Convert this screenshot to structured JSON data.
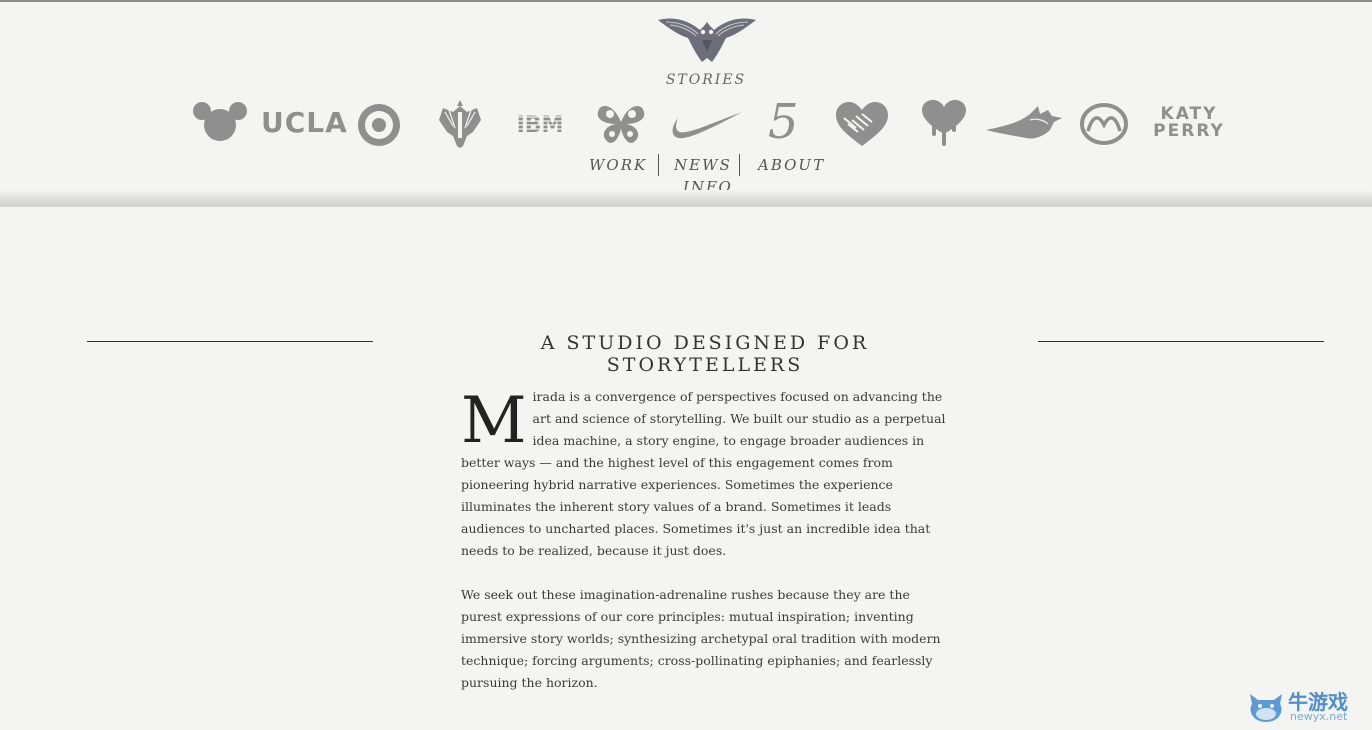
{
  "header": {
    "stories_label": "STORIES",
    "logos": [
      {
        "name": "mickey-logo-icon"
      },
      {
        "name": "ucla-logo",
        "text": "UCLA"
      },
      {
        "name": "target-logo-icon"
      },
      {
        "name": "pacific-rim-logo-icon"
      },
      {
        "name": "ibm-logo",
        "text": "IBM"
      },
      {
        "name": "butterfly-logo-icon"
      },
      {
        "name": "nike-swoosh-icon"
      },
      {
        "name": "five-logo",
        "text": "5"
      },
      {
        "name": "heart-handshake-icon"
      },
      {
        "name": "dripping-heart-icon"
      },
      {
        "name": "dragon-logo-icon"
      },
      {
        "name": "mazda-logo-icon"
      },
      {
        "name": "katy-perry-logo",
        "text": "KATY PERRY"
      }
    ],
    "nav": {
      "work": "WORK",
      "news": "NEWS",
      "about": "ABOUT",
      "info": "INFO"
    }
  },
  "main": {
    "headline": "A STUDIO DESIGNED FOR STORYTELLERS",
    "dropcap": "M",
    "paragraph1": "irada is a convergence of perspectives focused on advancing the art and science of storytelling. We built our studio as a perpetual idea machine, a story engine, to engage broader audiences in better ways — and the highest level of this engagement comes from pioneering hybrid narrative experiences. Sometimes the experience illuminates the inherent story values of a brand. Sometimes it leads audiences to uncharted places. Sometimes it's just an incredible idea that needs to be realized, because it just does.",
    "paragraph2": "We seek out these imagination-adrenaline rushes because they are the purest expressions of our core principles: mutual inspiration; inventing immersive story worlds; synthesizing archetypal oral tradition with modern technique; forcing arguments; cross-pollinating epiphanies; and fearlessly pursuing the horizon."
  },
  "watermark": {
    "text": "牛游戏",
    "sub": "newyx.net"
  },
  "colors": {
    "background": "#f4f4f2",
    "logo_gray": "#8f8f8f",
    "text": "#333333"
  }
}
